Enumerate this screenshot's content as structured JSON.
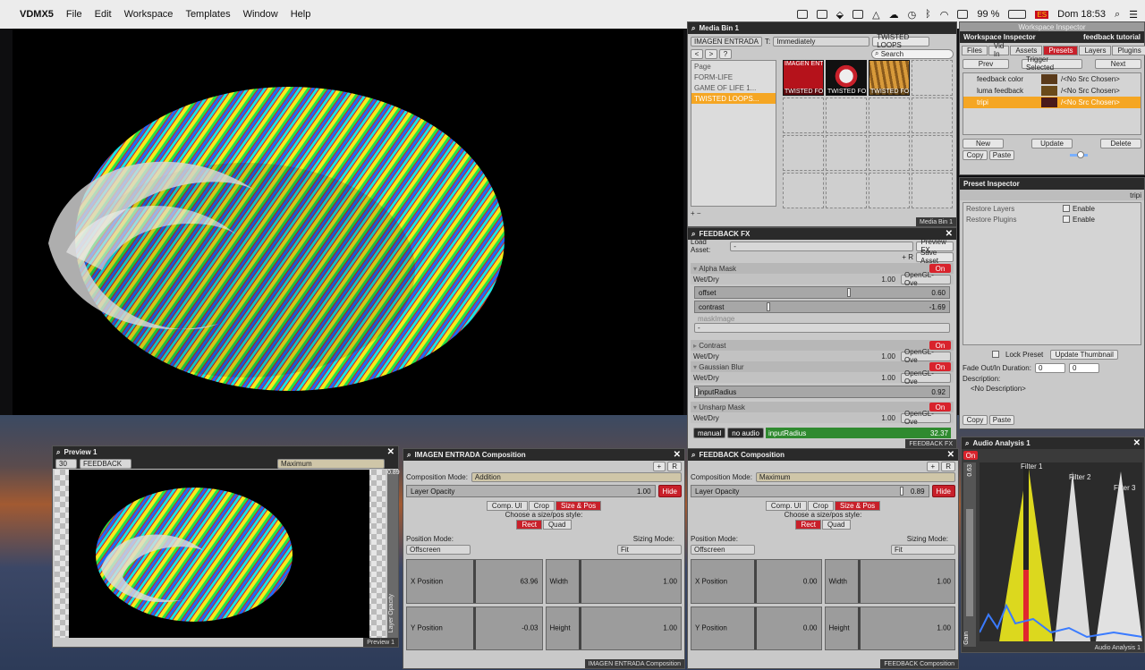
{
  "menubar": {
    "app": "VDMX5",
    "items": [
      "File",
      "Edit",
      "Workspace",
      "Templates",
      "Window",
      "Help"
    ],
    "battery": "99 %",
    "flag": "ES",
    "clock": "Dom 18:53"
  },
  "media_bin": {
    "title": "Media Bin 1",
    "source_select": "IMAGEN ENTRADA",
    "trigger_prefix": "T:",
    "trigger_select": "Immediately",
    "layer_select": "TWISTED LOOPS",
    "nav": [
      "<",
      ">",
      "?"
    ],
    "search_placeholder": "Search",
    "pages": [
      "Page",
      "FORM-LIFE",
      "GAME OF LIFE 1...",
      "TWISTED LOOPS..."
    ],
    "clips": [
      {
        "label": "TWISTED FO",
        "top": "IMAGEN ENT"
      },
      {
        "label": "TWISTED FO",
        "top": ""
      },
      {
        "label": "TWISTED FO",
        "top": ""
      }
    ],
    "add_remove": "+ −",
    "footer": "Media Bin 1"
  },
  "feedback_fx": {
    "title": "FEEDBACK FX",
    "load_asset": "Load Asset:",
    "load_asset_value": "-",
    "preview_fx": "Preview FX",
    "save_asset": "Save Asset",
    "plus_r": "+ R",
    "effects": [
      {
        "name": "Alpha Mask",
        "state": "On",
        "wetdry": "1.00",
        "blend": "OpenGL- Ove",
        "params": [
          {
            "name": "offset",
            "value": "0.60",
            "pos": 0.6
          },
          {
            "name": "contrast",
            "value": "-1.69",
            "pos": 0.02
          }
        ],
        "mask_label": "maskImage",
        "mask_value": "-"
      },
      {
        "name": "Contrast",
        "state": "On",
        "wetdry": "1.00",
        "blend": "OpenGL- Ove",
        "params": []
      },
      {
        "name": "Gaussian Blur",
        "state": "On",
        "wetdry": "1.00",
        "blend": "OpenGL- Ove",
        "params": [
          {
            "name": "inputRadius",
            "value": "0.92",
            "pos": 0.0
          }
        ]
      },
      {
        "name": "Unsharp Mask",
        "state": "On",
        "wetdry": "1.00",
        "blend": "OpenGL- Ove",
        "params": []
      }
    ],
    "wetdry_label": "Wet/Dry",
    "bottom": {
      "manual": "manual",
      "audio": "no audio",
      "param": "inputRadius",
      "value": "32.37",
      "level": 0.3
    },
    "footer": "FEEDBACK FX"
  },
  "workspace_inspector": {
    "window_title": "Workspace Inspector",
    "title": "Workspace Inspector",
    "context": "feedback tutorial",
    "tabs": [
      "Files",
      "Vid In",
      "Assets",
      "Presets",
      "Layers",
      "Plugins"
    ],
    "active_tab": "Presets",
    "prev": "Prev",
    "trigger": "Trigger Selected",
    "next": "Next",
    "presets": [
      {
        "name": "feedback color",
        "src": "/<No Src Chosen>"
      },
      {
        "name": "luma feedback",
        "src": "/<No Src Chosen>"
      },
      {
        "name": "tripi",
        "src": "/<No Src Chosen>"
      }
    ],
    "new": "New",
    "update": "Update",
    "delete": "Delete",
    "copy": "Copy",
    "paste": "Paste"
  },
  "preset_inspector": {
    "title": "Preset Inspector",
    "name": "tripi",
    "restore_layers": "Restore Layers",
    "restore_plugins": "Restore Plugins",
    "enable": "Enable",
    "lock_preset": "Lock Preset",
    "update_thumbnail": "Update Thumbnail",
    "fade_label": "Fade Out/In Duration:",
    "fade_out": "0",
    "fade_in": "0",
    "description_label": "Description:",
    "description": "<No Description>",
    "copy": "Copy",
    "paste": "Paste"
  },
  "preview": {
    "title": "Preview 1",
    "fps": "30",
    "source": "FEEDBACK",
    "mode": "Maximum",
    "opacity_value": "0.89",
    "opacity_label": "Layer Opacity",
    "footer": "Preview 1"
  },
  "imagen_comp": {
    "title": "IMAGEN ENTRADA Composition",
    "mode_label": "Composition Mode:",
    "mode": "Addition",
    "opacity_label": "Layer Opacity",
    "opacity": "1.00",
    "hide": "Hide",
    "tabs": [
      "Comp. UI",
      "Crop",
      "Size & Pos"
    ],
    "style_label": "Choose a size/pos style:",
    "styles": [
      "Rect",
      "Quad"
    ],
    "position_mode_label": "Position Mode:",
    "position_mode": "Offscreen",
    "sizing_mode_label": "Sizing Mode:",
    "sizing_mode": "Fit",
    "cells": [
      {
        "name": "X Position",
        "value": "63.96"
      },
      {
        "name": "Width",
        "value": "1.00"
      },
      {
        "name": "Y Position",
        "value": "-0.03"
      },
      {
        "name": "Height",
        "value": "1.00"
      }
    ],
    "footer": "IMAGEN ENTRADA Composition"
  },
  "feedback_comp": {
    "title": "FEEDBACK Composition",
    "mode_label": "Composition Mode:",
    "mode": "Maximum",
    "opacity_label": "Layer Opacity",
    "opacity": "0.89",
    "hide": "Hide",
    "tabs": [
      "Comp. UI",
      "Crop",
      "Size & Pos"
    ],
    "style_label": "Choose a size/pos style:",
    "styles": [
      "Rect",
      "Quad"
    ],
    "position_mode_label": "Position Mode:",
    "position_mode": "Offscreen",
    "sizing_mode_label": "Sizing Mode:",
    "sizing_mode": "Fit",
    "cells": [
      {
        "name": "X Position",
        "value": "0.00"
      },
      {
        "name": "Width",
        "value": "1.00"
      },
      {
        "name": "Y Position",
        "value": "0.00"
      },
      {
        "name": "Height",
        "value": "1.00"
      }
    ],
    "footer": "FEEDBACK Composition"
  },
  "audio": {
    "title": "Audio Analysis 1",
    "on": "On",
    "gain_value": "0.63",
    "gain_label": "Gain",
    "filters": [
      "Filter 1",
      "Filter 2",
      "Filter 3"
    ],
    "footer": "Audio Analysis 1"
  },
  "colors": {
    "accent": "#c8202a",
    "highlight": "#f5a623",
    "dark": "#2a2a2a"
  }
}
